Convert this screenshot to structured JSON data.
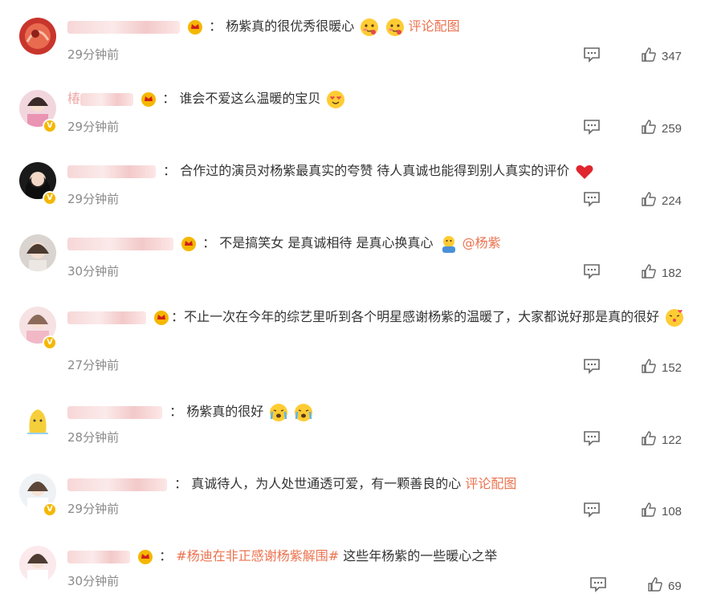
{
  "comments": [
    {
      "name_hidden": true,
      "sep": "：",
      "text": "杨紫真的很优秀很暖心",
      "extra_link": "评论配图",
      "time": "29分钟前",
      "likes": "347"
    },
    {
      "name_visible": "椿",
      "sep": "：",
      "text": "谁会不爱这么温暖的宝贝",
      "time": "29分钟前",
      "likes": "259"
    },
    {
      "sep": "：",
      "text": "合作过的演员对杨紫最真实的夸赞 待人真诚也能得到别人真实的评价",
      "time": "29分钟前",
      "likes": "224"
    },
    {
      "sep": "：",
      "text": "不是搞笑女 是真诚相待 是真心换真心",
      "mention": "@杨紫",
      "time": "30分钟前",
      "likes": "182"
    },
    {
      "sep": "：",
      "text": "不止一次在今年的综艺里听到各个明星感谢杨紫的温暖了，大家都说好那是真的很好",
      "time": "27分钟前",
      "likes": "152"
    },
    {
      "sep": "：",
      "text": "杨紫真的很好",
      "time": "28分钟前",
      "likes": "122"
    },
    {
      "sep": "：",
      "text": "真诚待人，为人处世通透可爱，有一颗善良的心",
      "extra_link": "评论配图",
      "time": "29分钟前",
      "likes": "108"
    },
    {
      "sep": "：",
      "hashtag": "#杨迪在非正感谢杨紫解围#",
      "text": "这些年杨紫的一些暖心之举",
      "time": "30分钟前",
      "likes": "69"
    }
  ],
  "colors": {
    "link": "#eb7350",
    "time": "#8a8a8a",
    "verified": "#f5b700"
  }
}
